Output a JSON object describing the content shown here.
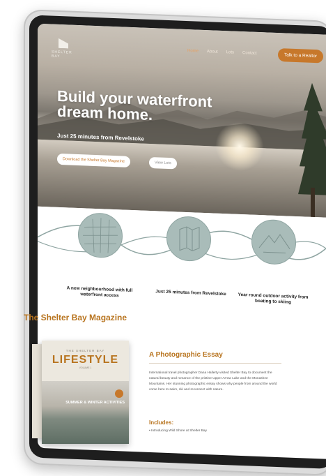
{
  "header": {
    "logo_text": "SHELTER BAY",
    "nav": [
      "Home",
      "About",
      "Lots",
      "Contact"
    ],
    "cta_label": "Talk to a Realtor"
  },
  "hero": {
    "headline": "Build your waterfront dream home.",
    "subheadline": "Just 25 minutes from Revelstoke",
    "primary_button": "Download the Shelter Bay Magazine",
    "secondary_button": "View Lots"
  },
  "features": [
    {
      "icon": "map-grid-icon",
      "text": "A new neighbourhood with full waterfront access"
    },
    {
      "icon": "folded-map-icon",
      "text": "Just 25 minutes from Revelstoke"
    },
    {
      "icon": "mountain-icon",
      "text": "Year round outdoor activity from boating to skiing"
    }
  ],
  "magazine": {
    "section_title": "The Shelter Bay Magazine",
    "cover_top": "THE SHELTER BAY",
    "cover_title": "LIFESTYLE",
    "cover_volume": "VOLUME 1",
    "cover_activities": "SUMMER & WINTER ACTIVITIES",
    "essay_title": "A Photographic Essay",
    "essay_body": "International travel photographer Dana Hallerty visited Shelter Bay to document the natural beauty and romance of the pristine Upper Arrow Lake and the Monashee Mountains. Her stunning photographic essay shows why people from around the world come here to swim, ski and reconnect with nature.",
    "includes_label": "Includes:",
    "includes": [
      "• Introducing Wild Shore at Shelter Bay"
    ]
  },
  "colors": {
    "accent": "#c7782b",
    "heading_gold": "#b8741f",
    "feature_circle": "#a9bcb9"
  }
}
